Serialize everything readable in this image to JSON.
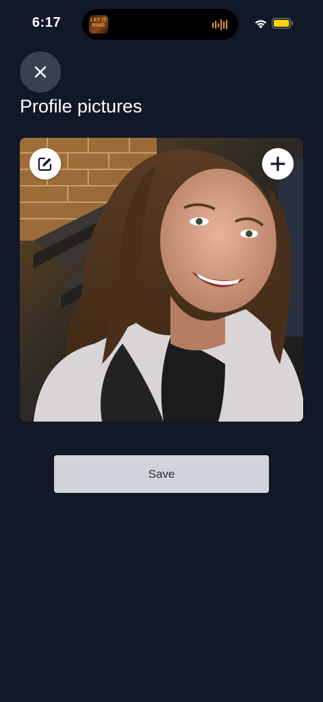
{
  "status_bar": {
    "time": "6:17",
    "now_playing_art_text": "LET IT RING",
    "battery_color": "#f5d60a"
  },
  "header": {
    "close_icon": "close-icon",
    "title": "Profile pictures"
  },
  "photo": {
    "description_icon": "profile-photo",
    "edit_icon": "edit-icon",
    "add_icon": "plus-icon"
  },
  "actions": {
    "save_label": "Save"
  },
  "colors": {
    "background": "#111827",
    "close_button_bg": "#374151",
    "save_button_bg": "#d1d5db",
    "save_button_text": "#1f2937"
  }
}
